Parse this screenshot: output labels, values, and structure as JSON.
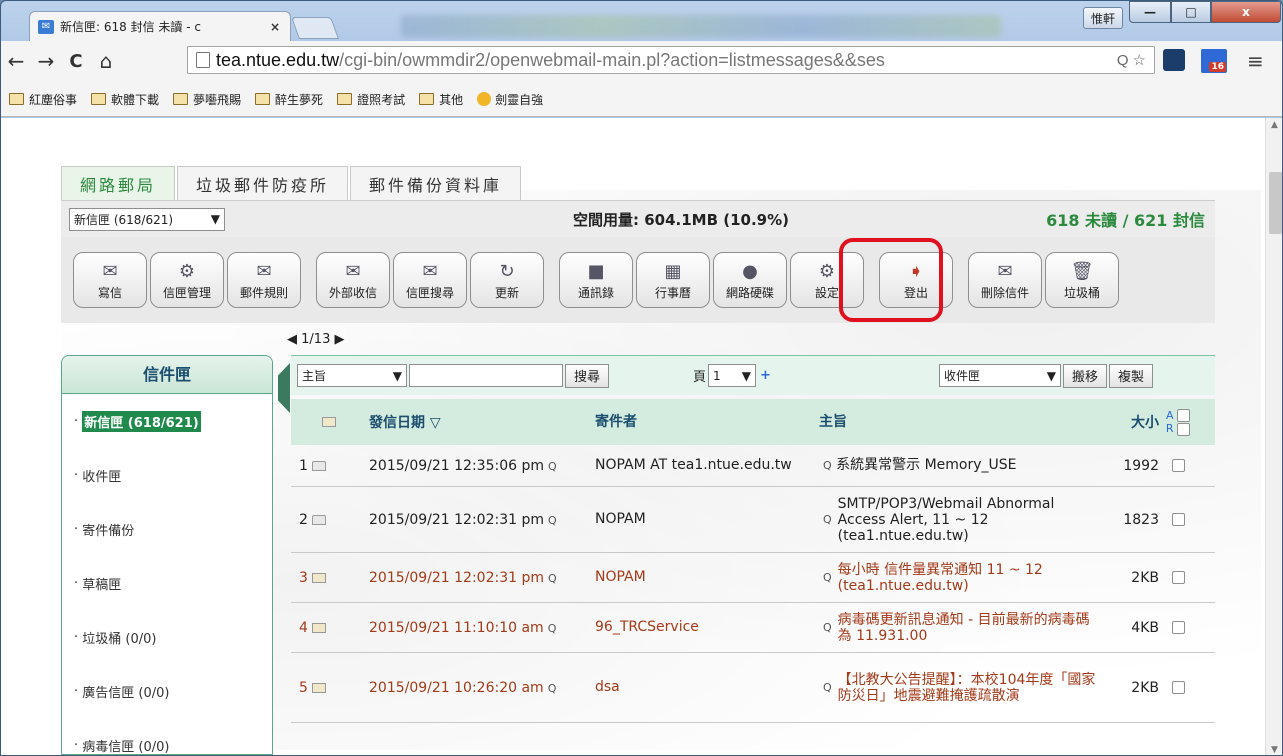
{
  "browser": {
    "tab_title": "新信匣: 618 封信 未讀 - c",
    "tab_close": "×",
    "user_label": "惟軒",
    "win_min": "—",
    "win_max": "□",
    "win_close": "x",
    "nav_back": "←",
    "nav_forward": "→",
    "nav_reload": "C",
    "nav_home": "⌂",
    "url_host": "tea.ntue.edu.tw",
    "url_path": "/cgi-bin/owmmdir2/openwebmail-main.pl?action=listmessages&&ses",
    "zoom_icon": "Q",
    "star_icon": "☆",
    "ext_badge": "16",
    "menu_icon": "≡",
    "bookmarks": [
      "紅塵俗事",
      "軟體下載",
      "夢囈飛賜",
      "醉生夢死",
      "證照考試",
      "其他",
      "劍靈自強"
    ]
  },
  "app": {
    "tabs": [
      "網路郵局",
      "垃圾郵件防疫所",
      "郵件備份資料庫"
    ],
    "folder_select": "新信匣 (618/621)",
    "quota": "空間用量: 604.1MB (10.9%)",
    "unread_summary": "618 未讀 / 621 封信",
    "toolbar": [
      "寫信",
      "信匣管理",
      "郵件規則",
      "外部收信",
      "信匣搜尋",
      "更新",
      "通訊錄",
      "行事曆",
      "網路硬碟",
      "設定",
      "登出",
      "刪除信件",
      "垃圾桶"
    ],
    "pager": "1/13",
    "sidebar_title": "信件匣",
    "folders": [
      "新信匣 (618/621)",
      "收件匣",
      "寄件備份",
      "草稿匣",
      "垃圾桶 (0/0)",
      "廣告信匣 (0/0)",
      "病毒信匣 (0/0)"
    ],
    "search": {
      "field": "主旨",
      "button": "搜尋",
      "page_label": "頁",
      "page_value": "1",
      "plus": "+",
      "target_folder": "收件匣",
      "move": "搬移",
      "copy": "複製"
    },
    "columns": {
      "date": "發信日期 ▽",
      "sender": "寄件者",
      "subject": "主旨",
      "size": "大小",
      "a": "A",
      "r": "R"
    },
    "messages": [
      {
        "n": "1",
        "date": "2015/09/21 12:35:06 pm",
        "sender": "NOPAM AT tea1.ntue.edu.tw",
        "subject": "系統異常警示 Memory_USE",
        "size": "1992"
      },
      {
        "n": "2",
        "date": "2015/09/21 12:02:31 pm",
        "sender": "NOPAM",
        "subject": "SMTP/POP3/Webmail Abnormal Access Alert, 11 ~ 12 (tea1.ntue.edu.tw)",
        "size": "1823"
      },
      {
        "n": "3",
        "date": "2015/09/21 12:02:31 pm",
        "sender": "NOPAM",
        "subject": "每小時 信件量異常通知 11 ~ 12 (tea1.ntue.edu.tw)",
        "size": "2KB"
      },
      {
        "n": "4",
        "date": "2015/09/21 11:10:10 am",
        "sender": "96_TRCService",
        "subject": "病毒碼更新訊息通知 - 目前最新的病毒碼為 11.931.00",
        "size": "4KB"
      },
      {
        "n": "5",
        "date": "2015/09/21 10:26:20 am",
        "sender": "dsa",
        "subject": "【北教大公告提醒】：本校104年度「國家防災日」地震避難掩護疏散演",
        "size": "2KB"
      }
    ]
  }
}
